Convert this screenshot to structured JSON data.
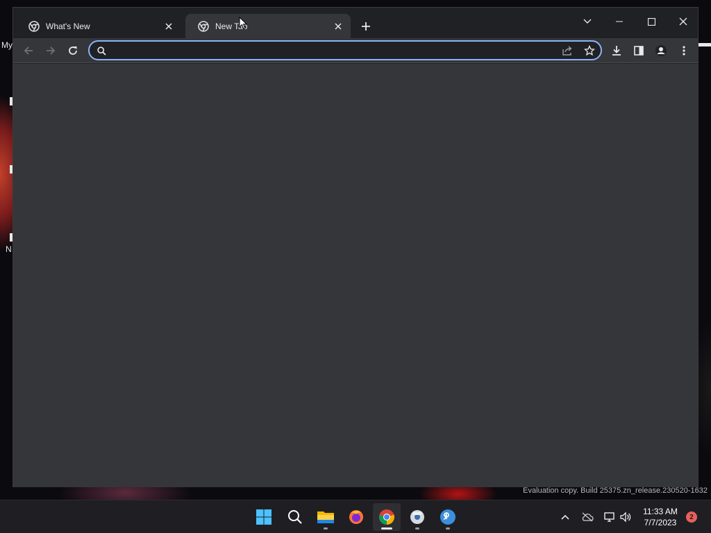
{
  "desktop": {
    "label_top": "My",
    "label_bottom": "N"
  },
  "browser": {
    "tabs": [
      {
        "title": "What's New",
        "active": false
      },
      {
        "title": "New Tab",
        "active": true
      }
    ],
    "omnibox": {
      "value": "",
      "placeholder": ""
    },
    "icons": {
      "back": "arrow-left-icon",
      "forward": "arrow-right-icon",
      "reload": "reload-icon",
      "share": "share-icon",
      "bookmark": "star-icon",
      "downloads": "download-icon",
      "side_panel": "side-panel-icon",
      "profile": "profile-icon",
      "menu": "kebab-menu-icon"
    }
  },
  "watermark": "Evaluation copy. Build 25375.zn_release.230520-1632",
  "taskbar": {
    "apps": [
      "start",
      "search",
      "file-explorer",
      "firefox",
      "chrome",
      "disk-app",
      "qbittorrent"
    ],
    "active_app": "chrome",
    "clock": {
      "time": "11:33 AM",
      "date": "7/7/2023"
    },
    "notification_count": "2"
  },
  "colors": {
    "accent": "#8ab4f8",
    "window_bg": "#202124",
    "toolbar_bg": "#35363a",
    "taskbar_bg": "#1f1f23",
    "notification": "#e8615a"
  }
}
